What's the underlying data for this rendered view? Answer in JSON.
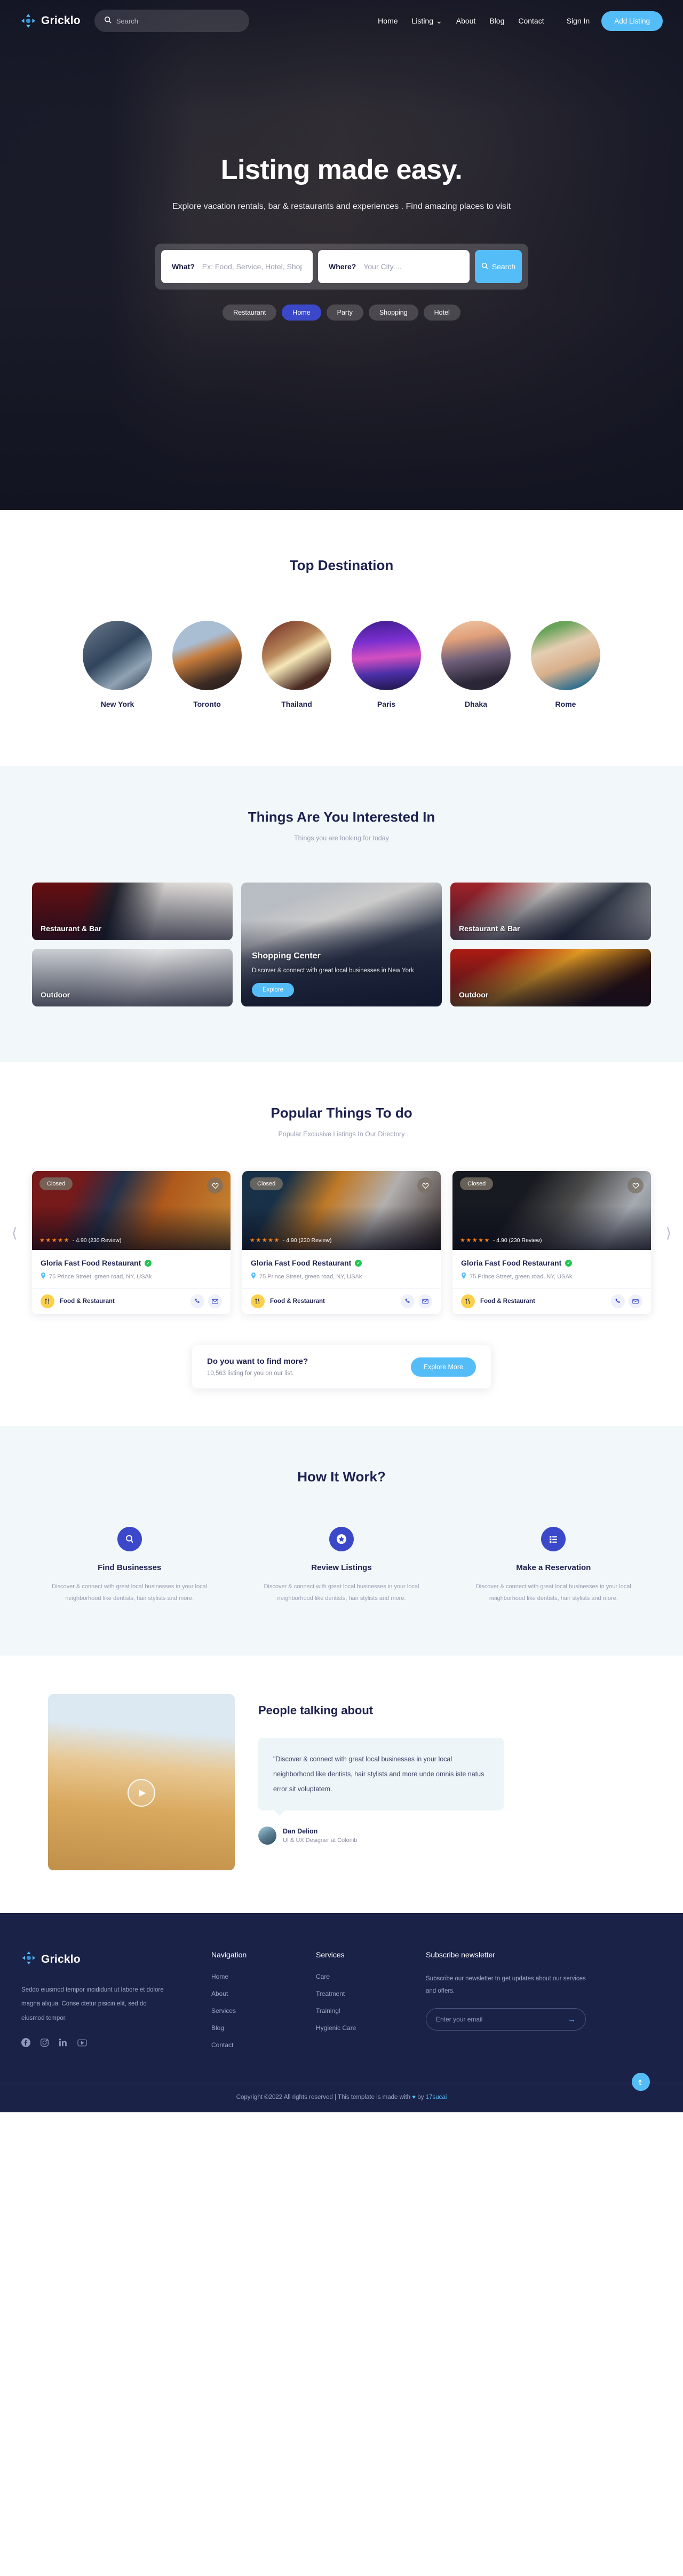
{
  "brand": {
    "name": "Gricklo",
    "logo_icon": "diamond-compass-icon"
  },
  "nav": {
    "search_placeholder": "Search",
    "search_icon": "search-icon",
    "links": [
      {
        "label": "Home"
      },
      {
        "label": "Listing",
        "caret": "⌄"
      },
      {
        "label": "About"
      },
      {
        "label": "Blog"
      },
      {
        "label": "Contact"
      }
    ],
    "signin": "Sign In",
    "add_listing": "Add Listing"
  },
  "hero": {
    "title": "Listing made easy.",
    "subtitle": "Explore vacation rentals, bar & restaurants and experiences . Find amazing places to visit",
    "what_label": "What?",
    "what_placeholder": "Ex: Food, Service, Hotel, Shopping",
    "where_label": "Where?",
    "where_placeholder": "Your City....",
    "search_button": "Search",
    "search_icon": "search-icon",
    "chips": [
      {
        "label": "Restaurant",
        "active": false
      },
      {
        "label": "Home",
        "active": true
      },
      {
        "label": "Party",
        "active": false
      },
      {
        "label": "Shopping",
        "active": false
      },
      {
        "label": "Hotel",
        "active": false
      }
    ]
  },
  "destinations": {
    "title": "Top Destination",
    "items": [
      {
        "name": "New York"
      },
      {
        "name": "Toronto"
      },
      {
        "name": "Thailand"
      },
      {
        "name": "Paris"
      },
      {
        "name": "Dhaka"
      },
      {
        "name": "Rome"
      }
    ]
  },
  "interests": {
    "title": "Things Are You Interested In",
    "subtitle": "Things you are looking for today",
    "cards": [
      {
        "label": "Restaurant & Bar"
      },
      {
        "label": "Outdoor"
      },
      {
        "label": "Restaurant & Bar"
      },
      {
        "label": "Outdoor"
      }
    ],
    "feature": {
      "title": "Shopping Center",
      "desc": "Discover & connect with great local businesses in New York",
      "button": "Explore"
    }
  },
  "popular": {
    "title": "Popular Things To do",
    "subtitle": "Popular Exclusive Listings In Our Directory",
    "prev_icon": "chevron-left-icon",
    "next_icon": "chevron-right-icon",
    "listings": [
      {
        "status": "Closed",
        "stars": "★★★★★",
        "rating_text": "- 4.90 (230 Review)",
        "name": "Gloria Fast Food Restaurant",
        "verified": true,
        "address": "75 Prince Street, green road, NY, USAk",
        "category": "Food & Restaurant",
        "category_icon": "cutlery-icon",
        "phone_icon": "phone-icon",
        "mail_icon": "mail-icon",
        "fav_icon": "heart-icon",
        "pin_icon": "map-pin-icon"
      },
      {
        "status": "Closed",
        "stars": "★★★★★",
        "rating_text": "- 4.90 (230 Review)",
        "name": "Gloria Fast Food Restaurant",
        "verified": true,
        "address": "75 Prince Street, green road, NY, USAk",
        "category": "Food & Restaurant",
        "category_icon": "cutlery-icon",
        "phone_icon": "phone-icon",
        "mail_icon": "mail-icon",
        "fav_icon": "heart-icon",
        "pin_icon": "map-pin-icon"
      },
      {
        "status": "Closed",
        "stars": "★★★★★",
        "rating_text": "- 4.90 (230 Review)",
        "name": "Gloria Fast Food Restaurant",
        "verified": true,
        "address": "75 Prince Street, green road, NY, USAk",
        "category": "Food & Restaurant",
        "category_icon": "cutlery-icon",
        "phone_icon": "phone-icon",
        "mail_icon": "mail-icon",
        "fav_icon": "heart-icon",
        "pin_icon": "map-pin-icon"
      }
    ],
    "findmore": {
      "title": "Do you want to find more?",
      "sub": "10,563 listing for you on our list.",
      "button": "Explore More"
    }
  },
  "how": {
    "title": "How It Work?",
    "items": [
      {
        "icon": "search-icon",
        "title": "Find Businesses",
        "desc": "Discover & connect with great local businesses in your local neighborhood like dentists, hair stylists and more."
      },
      {
        "icon": "star-badge-icon",
        "title": "Review Listings",
        "desc": "Discover & connect with great local businesses in your local neighborhood like dentists, hair stylists and more."
      },
      {
        "icon": "list-icon",
        "title": "Make a Reservation",
        "desc": "Discover & connect with great local businesses in your local neighborhood like dentists, hair stylists and more."
      }
    ]
  },
  "testimonial": {
    "title": "People talking about",
    "play_icon": "play-icon",
    "quote": "\"Discover & connect with great local businesses in your local neighborhood like dentists, hair stylists and more unde omnis iste natus error sit voluptatem.",
    "author_name": "Dan Delion",
    "author_role": "UI & UX Designer at Colorlib"
  },
  "footer": {
    "about": "Seddo eiusmod tempor incididunt ut labore et dolore magna aliqua. Conse ctetur pisicin elit, sed do eiusmod tempor.",
    "socials": [
      "facebook-icon",
      "instagram-icon",
      "linkedin-icon",
      "youtube-icon"
    ],
    "nav_heading": "Navigation",
    "nav_links": [
      "Home",
      "About",
      "Services",
      "Blog",
      "Contact"
    ],
    "services_heading": "Services",
    "services_links": [
      "Care",
      "Treatment",
      "Trainingl",
      "Hygienic Care"
    ],
    "newsletter_heading": "Subscribe newsletter",
    "newsletter_text": "Subscribe our newsletter to get updates about our services and offers.",
    "email_placeholder": "Enter your email",
    "submit_icon": "arrow-right-icon",
    "copyright_pre": "Copyright ©2022 All rights reserved | This template is made with ",
    "copyright_heart": "♥",
    "copyright_mid": " by ",
    "copyright_link": "17sucai",
    "totop_icon": "arrow-up-icon"
  }
}
